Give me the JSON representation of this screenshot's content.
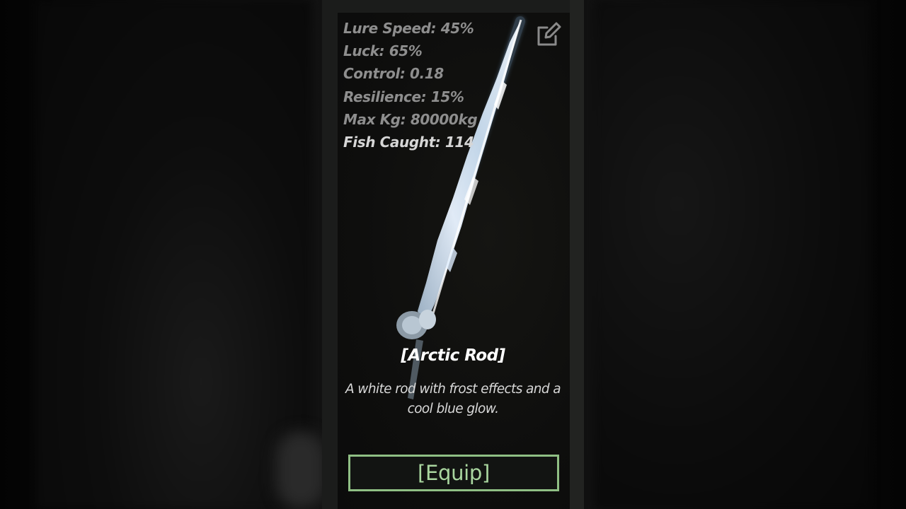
{
  "item": {
    "name": "[Arctic Rod]",
    "description": "A white rod with frost effects and a cool blue glow.",
    "stats": [
      {
        "label": "Lure Speed: 45%"
      },
      {
        "label": "Luck: 65%"
      },
      {
        "label": "Control: 0.18"
      },
      {
        "label": "Resilience: 15%"
      },
      {
        "label": "Max Kg: 80000kg"
      },
      {
        "label": "Fish Caught: 114"
      }
    ],
    "icon": "fishing-rod-icon"
  },
  "actions": {
    "equip_label": "[Equip]",
    "edit_icon": "edit-icon"
  },
  "colors": {
    "stat_text": "#8e8e8e",
    "stat_highlight": "#d6d6d6",
    "equip_border": "#8fbf84",
    "equip_text": "#a9d69f",
    "rod_glow": "#bfe0ff"
  }
}
